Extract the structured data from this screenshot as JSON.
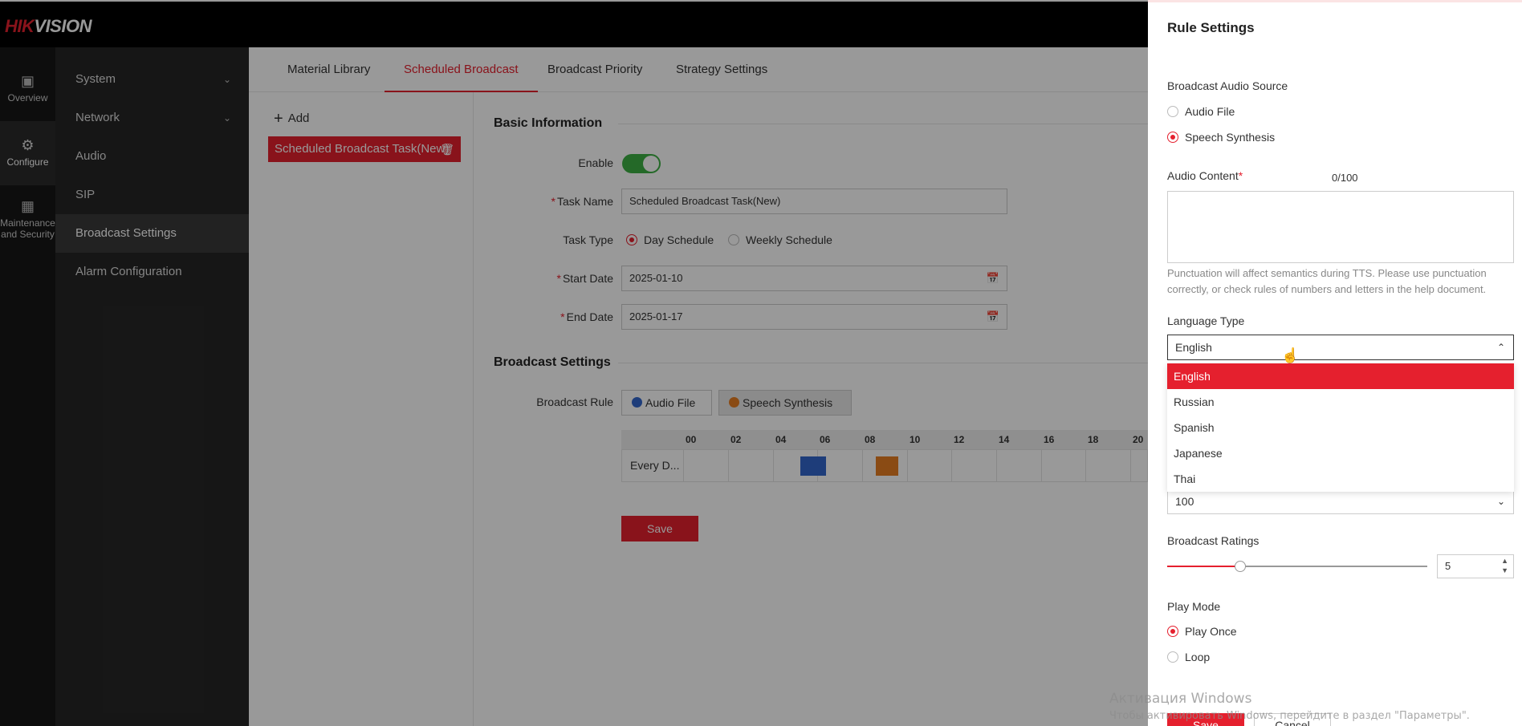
{
  "brand": {
    "logo_red": "HIK",
    "logo_white": "VISION"
  },
  "rail": [
    {
      "label": "Overview",
      "icon": "image-icon"
    },
    {
      "label": "Configure",
      "icon": "gear-icon"
    },
    {
      "label": "Maintenance and Security",
      "icon": "wrench-icon"
    }
  ],
  "menu": [
    {
      "label": "System",
      "expandable": true
    },
    {
      "label": "Network",
      "expandable": true
    },
    {
      "label": "Audio"
    },
    {
      "label": "SIP"
    },
    {
      "label": "Broadcast Settings",
      "active": true
    },
    {
      "label": "Alarm Configuration"
    }
  ],
  "tabs": [
    "Material Library",
    "Scheduled Broadcast",
    "Broadcast Priority",
    "Strategy Settings"
  ],
  "active_tab": "Scheduled Broadcast",
  "tasks": {
    "add_label": "Add",
    "items": [
      "Scheduled Broadcast Task(New)"
    ]
  },
  "basic": {
    "title": "Basic Information",
    "enable_label": "Enable",
    "enable_on": true,
    "task_name_label": "Task Name",
    "task_name_value": "Scheduled Broadcast Task(New)",
    "task_type_label": "Task Type",
    "task_type_options": [
      "Day Schedule",
      "Weekly Schedule"
    ],
    "task_type_selected": "Day Schedule",
    "start_date_label": "Start Date",
    "start_date_value": "2025-01-10",
    "end_date_label": "End Date",
    "end_date_value": "2025-01-17"
  },
  "broadcast": {
    "title": "Broadcast Settings",
    "rule_label": "Broadcast Rule",
    "rule_audio_file": "Audio File",
    "rule_speech": "Speech Synthesis",
    "colors": {
      "audio_file": "#3366cc",
      "speech": "#e67e22"
    },
    "ticks": [
      "00",
      "02",
      "04",
      "06",
      "08",
      "10",
      "12",
      "14",
      "16",
      "18",
      "20"
    ],
    "row_label": "Every D...",
    "save_label": "Save"
  },
  "drawer": {
    "title": "Rule Settings",
    "source_label": "Broadcast Audio Source",
    "source_options": [
      "Audio File",
      "Speech Synthesis"
    ],
    "source_selected": "Speech Synthesis",
    "content_label": "Audio Content",
    "content_counter": "0/100",
    "hint": "Punctuation will affect semantics during TTS. Please use punctuation correctly, or check rules of numbers and letters in the help document.",
    "language_label": "Language Type",
    "language_value": "English",
    "language_options": [
      "English",
      "Russian",
      "Spanish",
      "Japanese",
      "Thai"
    ],
    "volume_value": "100",
    "ratings_label": "Broadcast Ratings",
    "ratings_value": "5",
    "ratings_fraction": 0.28,
    "play_mode_label": "Play Mode",
    "play_mode_options": [
      "Play Once",
      "Loop"
    ],
    "play_mode_selected": "Play Once",
    "save_label": "Save",
    "cancel_label": "Cancel"
  },
  "activation": {
    "line1": "Активация Windows",
    "line2": "Чтобы активировать Windows, перейдите в раздел \"Параметры\"."
  },
  "accent_color": "#e5202e"
}
